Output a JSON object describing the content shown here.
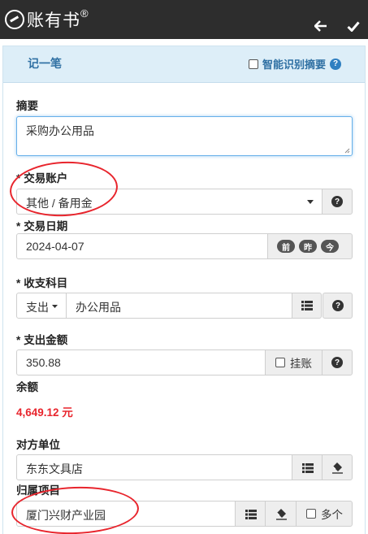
{
  "app": {
    "title": "账有书",
    "reg_mark": "®"
  },
  "panel": {
    "title": "记一笔",
    "smart_label": "智能识别摘要",
    "help": "?"
  },
  "summary": {
    "label": "摘要",
    "value": "采购办公用品"
  },
  "account": {
    "required": "*",
    "label": "交易账户",
    "value": "其他 / 备用金"
  },
  "date": {
    "required": "*",
    "label": "交易日期",
    "value": "2024-04-07",
    "btn_prev": "前",
    "btn_yesterday": "昨",
    "btn_today": "今"
  },
  "subject": {
    "required": "*",
    "label": "收支科目",
    "type": "支出",
    "value": "办公用品"
  },
  "amount": {
    "required": "*",
    "label": "支出金额",
    "value": "350.88",
    "on_account_label": "挂账"
  },
  "balance": {
    "label": "余额",
    "value": "4,649.12 元",
    "color": "#e8252d"
  },
  "counterparty": {
    "label": "对方单位",
    "value": "东东文具店"
  },
  "project": {
    "label": "归属项目",
    "value": "厦门兴财产业园",
    "multi_label": "多个"
  },
  "icons": [
    "back-arrow-icon",
    "checkmark-icon",
    "help-icon",
    "caret-down-icon",
    "list-icon",
    "eraser-icon",
    "checkbox-icon"
  ]
}
